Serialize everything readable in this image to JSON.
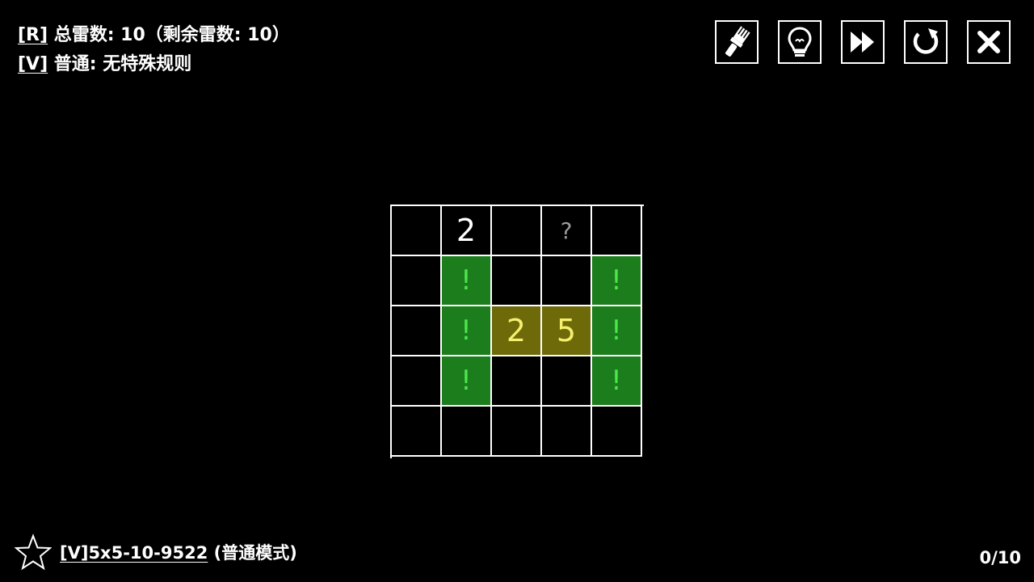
{
  "info": {
    "line1_tag": "[R]",
    "line1_text": " 总雷数:  10（剩余雷数: 10）",
    "line2_tag": "[V]",
    "line2_text": " 普通: 无特殊规则"
  },
  "toolbar": [
    {
      "name": "brush-icon"
    },
    {
      "name": "lightbulb-icon"
    },
    {
      "name": "fast-forward-icon"
    },
    {
      "name": "restart-icon"
    },
    {
      "name": "close-icon"
    }
  ],
  "board": {
    "rows": 5,
    "cols": 5,
    "cells": [
      [
        "",
        "2",
        "",
        "?",
        ""
      ],
      [
        "",
        "!",
        "",
        "",
        "!"
      ],
      [
        "",
        "!",
        "2",
        "5",
        "!"
      ],
      [
        "",
        "!",
        "",
        "",
        "!"
      ],
      [
        "",
        "",
        "",
        "",
        ""
      ]
    ],
    "highlighted": [
      [
        2,
        2
      ],
      [
        2,
        3
      ]
    ]
  },
  "footer": {
    "level_code": "[V]5x5-10-9522",
    "mode_label": " (普通模式)",
    "progress": "0/10"
  },
  "colors": {
    "background": "#000000",
    "flag_cell": "#1b7d1b",
    "flag_mark": "#4ee64e",
    "highlight_cell": "#6e6a0a",
    "highlight_text": "#f4ef6e",
    "question_mark": "#9a9a9a"
  }
}
